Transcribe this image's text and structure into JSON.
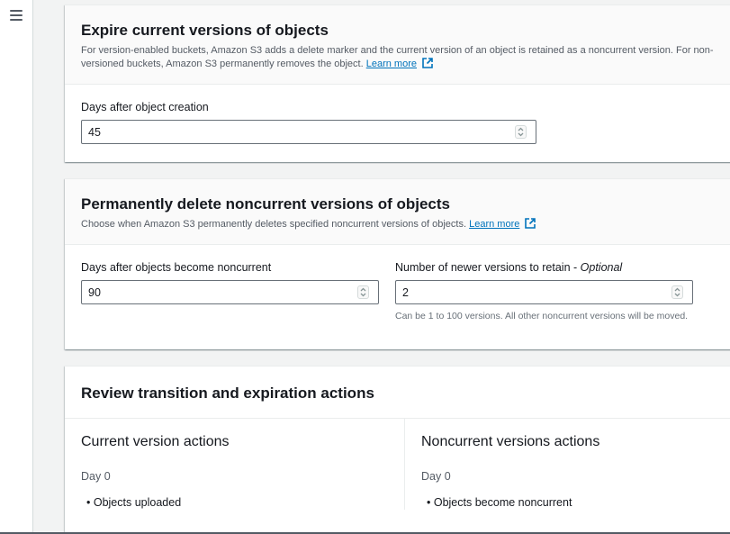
{
  "nav": {
    "menu_icon": "hamburger-menu-icon"
  },
  "expire_panel": {
    "title": "Expire current versions of objects",
    "description": "For version-enabled buckets, Amazon S3 adds a delete marker and the current version of an object is retained as a noncurrent version. For non-versioned buckets, Amazon S3 permanently removes the object.",
    "learn_more": "Learn more",
    "field_label": "Days after object creation",
    "field_value": "45"
  },
  "delete_panel": {
    "title": "Permanently delete noncurrent versions of objects",
    "description": "Choose when Amazon S3 permanently deletes specified noncurrent versions of objects.",
    "learn_more": "Learn more",
    "days_label": "Days after objects become noncurrent",
    "days_value": "90",
    "retain_label": "Number of newer versions to retain - ",
    "retain_optional": "Optional",
    "retain_value": "2",
    "retain_hint": "Can be 1 to 100 versions. All other noncurrent versions will be moved."
  },
  "review_panel": {
    "title": "Review transition and expiration actions",
    "current": {
      "title": "Current version actions",
      "day": "Day 0",
      "item": "Objects uploaded"
    },
    "noncurrent": {
      "title": "Noncurrent versions actions",
      "day": "Day 0",
      "item": "Objects become noncurrent"
    }
  },
  "colors": {
    "link": "#0073bb",
    "border": "#687078",
    "background": "#f2f3f3"
  }
}
